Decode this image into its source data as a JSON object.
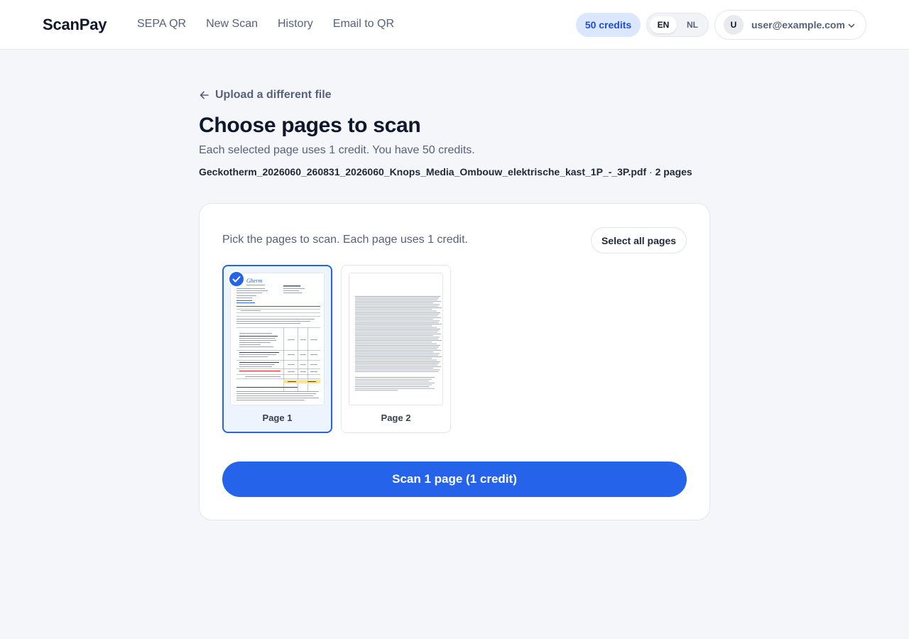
{
  "header": {
    "brand": "ScanPay",
    "nav": [
      "SEPA QR",
      "New Scan",
      "History",
      "Email to QR"
    ],
    "credits_badge": "50 credits",
    "languages": {
      "active": "EN",
      "other": "NL"
    },
    "user": {
      "avatar_initial": "U",
      "email": "user@example.com"
    }
  },
  "main": {
    "back_link": "Upload a different file",
    "title": "Choose pages to scan",
    "subtitle": "Each selected page uses 1 credit. You have 50 credits.",
    "file_name": "Geckotherm_2026060_260831_2026060_Knops_Media_Ombouw_elektrische_kast_1P_-_3P.pdf",
    "file_separator": " · ",
    "file_pages": "2 pages"
  },
  "card": {
    "instruction": "Pick the pages to scan. Each page uses 1 credit.",
    "select_all": "Select all pages",
    "pages": [
      {
        "label": "Page 1",
        "selected": true
      },
      {
        "label": "Page 2",
        "selected": false
      }
    ],
    "scan_button": "Scan 1 page (1 credit)"
  },
  "colors": {
    "accent": "#2563eb",
    "badge_bg": "#dbe7fe",
    "badge_text": "#1d4ed8",
    "page_bg": "#f5f6fa"
  },
  "icons": [
    "arrow-left-icon",
    "chevron-down-icon",
    "check-icon"
  ]
}
